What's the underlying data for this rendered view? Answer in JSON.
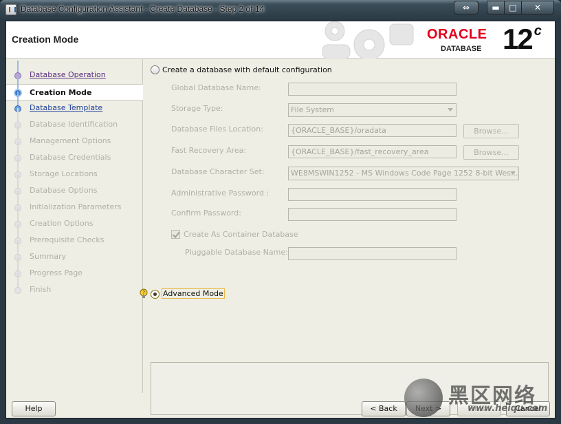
{
  "window": {
    "title": "Database Configuration Assistant - Create Database - Step 2 of 14",
    "resize_glyph": "⇔",
    "min_glyph": "▬",
    "max_glyph": "□",
    "close_glyph": "✕"
  },
  "header": {
    "title": "Creation Mode",
    "brand": "ORACLE",
    "brand_sub": "DATABASE",
    "version": "12",
    "version_suffix": "c"
  },
  "steps": [
    {
      "label": "Database Operation",
      "state": "done"
    },
    {
      "label": "Creation Mode",
      "state": "current"
    },
    {
      "label": "Database Template",
      "state": "link"
    },
    {
      "label": "Database Identification",
      "state": "pending"
    },
    {
      "label": "Management Options",
      "state": "pending"
    },
    {
      "label": "Database Credentials",
      "state": "pending"
    },
    {
      "label": "Storage Locations",
      "state": "pending"
    },
    {
      "label": "Database Options",
      "state": "pending"
    },
    {
      "label": "Initialization Parameters",
      "state": "pending"
    },
    {
      "label": "Creation Options",
      "state": "pending"
    },
    {
      "label": "Prerequisite Checks",
      "state": "pending"
    },
    {
      "label": "Summary",
      "state": "pending"
    },
    {
      "label": "Progress Page",
      "state": "pending"
    },
    {
      "label": "Finish",
      "state": "pending"
    }
  ],
  "default_config": {
    "label": "Create a database with default configuration",
    "selected": false,
    "global_db_name": {
      "label": "Global Database Name:",
      "value": ""
    },
    "storage_type": {
      "label": "Storage Type:",
      "value": "File System"
    },
    "files_location": {
      "label": "Database Files Location:",
      "value": "{ORACLE_BASE}/oradata",
      "browse": "Browse..."
    },
    "recovery_area": {
      "label": "Fast Recovery Area:",
      "value": "{ORACLE_BASE}/fast_recovery_area",
      "browse": "Browse..."
    },
    "charset": {
      "label": "Database Character Set:",
      "value": "WE8MSWIN1252 - MS Windows Code Page 1252 8-bit Wes..."
    },
    "admin_password": {
      "label": "Administrative Password :",
      "value": ""
    },
    "confirm_password": {
      "label": "Confirm Password:",
      "value": ""
    },
    "container_db": {
      "label": "Create As Container Database",
      "checked": true
    },
    "pluggable_name": {
      "label": "Pluggable Database Name:",
      "value": ""
    }
  },
  "advanced_mode": {
    "label": "Advanced Mode",
    "selected": true
  },
  "buttons": {
    "help": "Help",
    "back": "< Back",
    "next": "Next >",
    "finish": "Finish",
    "cancel": "Cancel"
  },
  "watermark": {
    "text": "黑区网络",
    "url": "www.heiqu.com"
  }
}
